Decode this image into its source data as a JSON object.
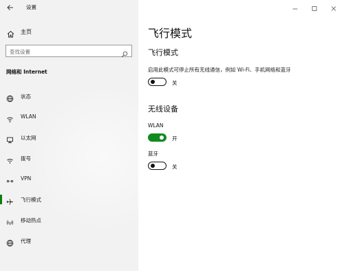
{
  "window": {
    "title": "设置",
    "controls": {
      "minimize_icon": "minimize-icon",
      "maximize_icon": "maximize-icon",
      "close_icon": "close-icon"
    }
  },
  "sidebar": {
    "home_label": "主页",
    "search_placeholder": "查找设置",
    "section_heading": "网络和 Internet",
    "items": [
      {
        "label": "状态",
        "icon": "globe-status-icon",
        "selected": false
      },
      {
        "label": "WLAN",
        "icon": "wifi-icon",
        "selected": false
      },
      {
        "label": "以太网",
        "icon": "ethernet-icon",
        "selected": false
      },
      {
        "label": "拨号",
        "icon": "dialup-icon",
        "selected": false
      },
      {
        "label": "VPN",
        "icon": "vpn-icon",
        "selected": false
      },
      {
        "label": "飞行模式",
        "icon": "airplane-icon",
        "selected": true
      },
      {
        "label": "移动热点",
        "icon": "hotspot-icon",
        "selected": false
      },
      {
        "label": "代理",
        "icon": "globe-proxy-icon",
        "selected": false
      }
    ],
    "accent_color": "#107c10"
  },
  "main": {
    "page_title": "飞行模式",
    "airplane": {
      "heading": "飞行模式",
      "description": "启用此模式可停止所有无线通信，例如 Wi-Fi、手机网络和蓝牙",
      "state": "关",
      "on": false
    },
    "wireless_heading": "无线设备",
    "devices": [
      {
        "name": "WLAN",
        "state": "开",
        "on": true
      },
      {
        "name": "蓝牙",
        "state": "关",
        "on": false
      }
    ],
    "toggle_on_color": "#138a1f"
  }
}
